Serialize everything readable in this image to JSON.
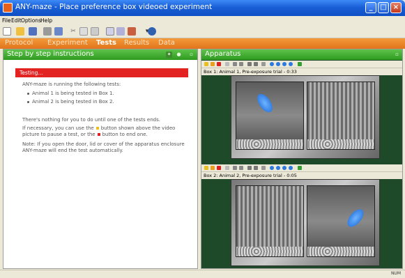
{
  "window": {
    "title": "ANY-maze - Place preference box videoed experiment"
  },
  "menubar": {
    "items": [
      "File",
      "Edit",
      "Options",
      "Help"
    ]
  },
  "tabs": {
    "items": [
      "Protocol",
      "Experiment",
      "Tests",
      "Results",
      "Data"
    ],
    "active": "Tests"
  },
  "instructions": {
    "header": "Step by step instructions",
    "status": "Testing...",
    "intro": "ANY-maze is running the following tests:",
    "tests": [
      "Animal 1 is being tested in Box 1.",
      "Animal 2 is being tested in Box 2."
    ],
    "wait": "There's nothing for you to do until one of the tests ends.",
    "pause_line1_a": "If necessary, you can use the",
    "pause_line1_b": "button shown above the video",
    "pause_line2_a": "picture to pause a test, or the",
    "pause_line2_b": "button to end one.",
    "note_line1": "Note: If you open the door, lid or cover of the apparatus enclosure",
    "note_line2": "ANY-maze will end the test automatically."
  },
  "apparatus": {
    "header": "Apparatus",
    "box1_label": "Box 1: Animal 1, Pre-exposure trial - 0:33",
    "box2_label": "Box 2: Animal 2, Pre-exposure trial - 0:05"
  },
  "statusbar": {
    "num": "NUM"
  },
  "colors": {
    "accent_orange": "#e0741c",
    "panel_green": "#2f9a20",
    "testing_red": "#e32222",
    "mouse_blue": "#1a6ad8"
  }
}
